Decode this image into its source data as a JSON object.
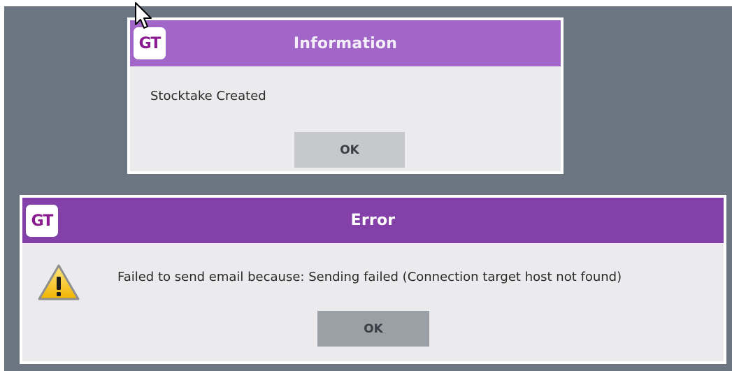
{
  "info_dialog": {
    "title": "Information",
    "logo_text": "GT",
    "message": "Stocktake Created",
    "ok_label": "OK",
    "title_color": "#a266c9"
  },
  "error_dialog": {
    "title": "Error",
    "logo_text": "GT",
    "message": "Failed to send email because: Sending failed (Connection target host not found)",
    "ok_label": "OK",
    "icon": "warning-icon",
    "title_color": "#8240a8"
  },
  "colors": {
    "backdrop": "#6b7682",
    "dialog_body": "#ebebed",
    "info_ok_button": "#c6c8cc",
    "error_ok_button": "#9ba0a6",
    "logo_text": "#8a1a8f"
  }
}
